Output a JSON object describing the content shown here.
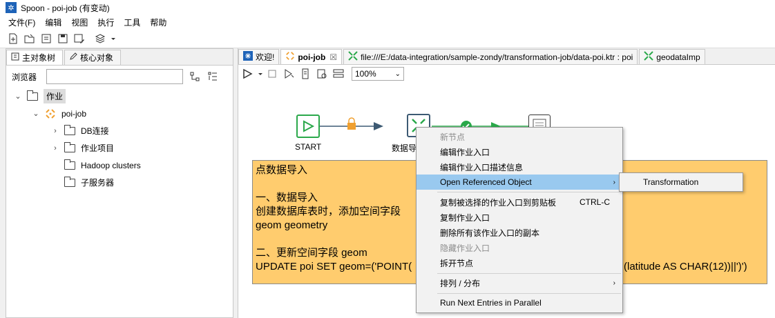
{
  "window": {
    "title": "Spoon - poi-job (有变动)"
  },
  "menubar": [
    "文件(F)",
    "编辑",
    "视图",
    "执行",
    "工具",
    "帮助"
  ],
  "left_panel": {
    "tabs": [
      {
        "label": "主对象树",
        "icon": "tree-icon"
      },
      {
        "label": "核心对象",
        "icon": "pencil-icon"
      }
    ],
    "browser_label": "浏览器",
    "search_value": "",
    "tree": [
      {
        "label": "作业",
        "level": 0,
        "expanded": true,
        "selected": true
      },
      {
        "label": "poi-job",
        "level": 1,
        "expanded": true
      },
      {
        "label": "DB连接",
        "level": 2,
        "expandable": true
      },
      {
        "label": "作业项目",
        "level": 2,
        "expandable": true
      },
      {
        "label": "Hadoop clusters",
        "level": 2,
        "expandable": false
      },
      {
        "label": "子服务器",
        "level": 2,
        "expandable": false
      }
    ]
  },
  "editor_tabs": [
    {
      "label": "欢迎!",
      "icon": "spoon-icon",
      "active": false
    },
    {
      "label": "poi-job",
      "icon": "job-icon",
      "active": true,
      "close": "☒"
    },
    {
      "label": "file:///E:/data-integration/sample-zondy/transformation-job/data-poi.ktr : poi",
      "icon": "transformation-icon",
      "active": false
    },
    {
      "label": "geodataImp",
      "icon": "transformation-icon",
      "active": false
    }
  ],
  "run_bar": {
    "zoom": "100%"
  },
  "canvas": {
    "nodes": [
      {
        "label": "START"
      },
      {
        "label": "数据导"
      }
    ],
    "note_lines": [
      "点数据导入",
      "",
      "一、数据导入",
      "创建数据库表时，添加空间字段",
      "geom geometry",
      "",
      "二、更新空间字段 geom",
      "UPDATE poi SET geom=('POINT("
    ],
    "note_tail": "(latitude AS CHAR(12))||')')"
  },
  "context_menu": {
    "items": [
      {
        "label": "新节点",
        "disabled": true
      },
      {
        "label": "编辑作业入口"
      },
      {
        "label": "编辑作业入口描述信息"
      },
      {
        "label": "Open Referenced Object",
        "submenu": true,
        "hover": true
      },
      {
        "label": "复制被选择的作业入口到剪贴板",
        "shortcut": "CTRL-C"
      },
      {
        "label": "复制作业入口"
      },
      {
        "label": "删除所有该作业入口的副本"
      },
      {
        "label": "隐藏作业入口",
        "disabled": true
      },
      {
        "label": "拆开节点"
      },
      {
        "label": "排列 / 分布",
        "submenu": true
      },
      {
        "label": "Run Next Entries in Parallel"
      }
    ],
    "submenu_item": "Transformation"
  }
}
